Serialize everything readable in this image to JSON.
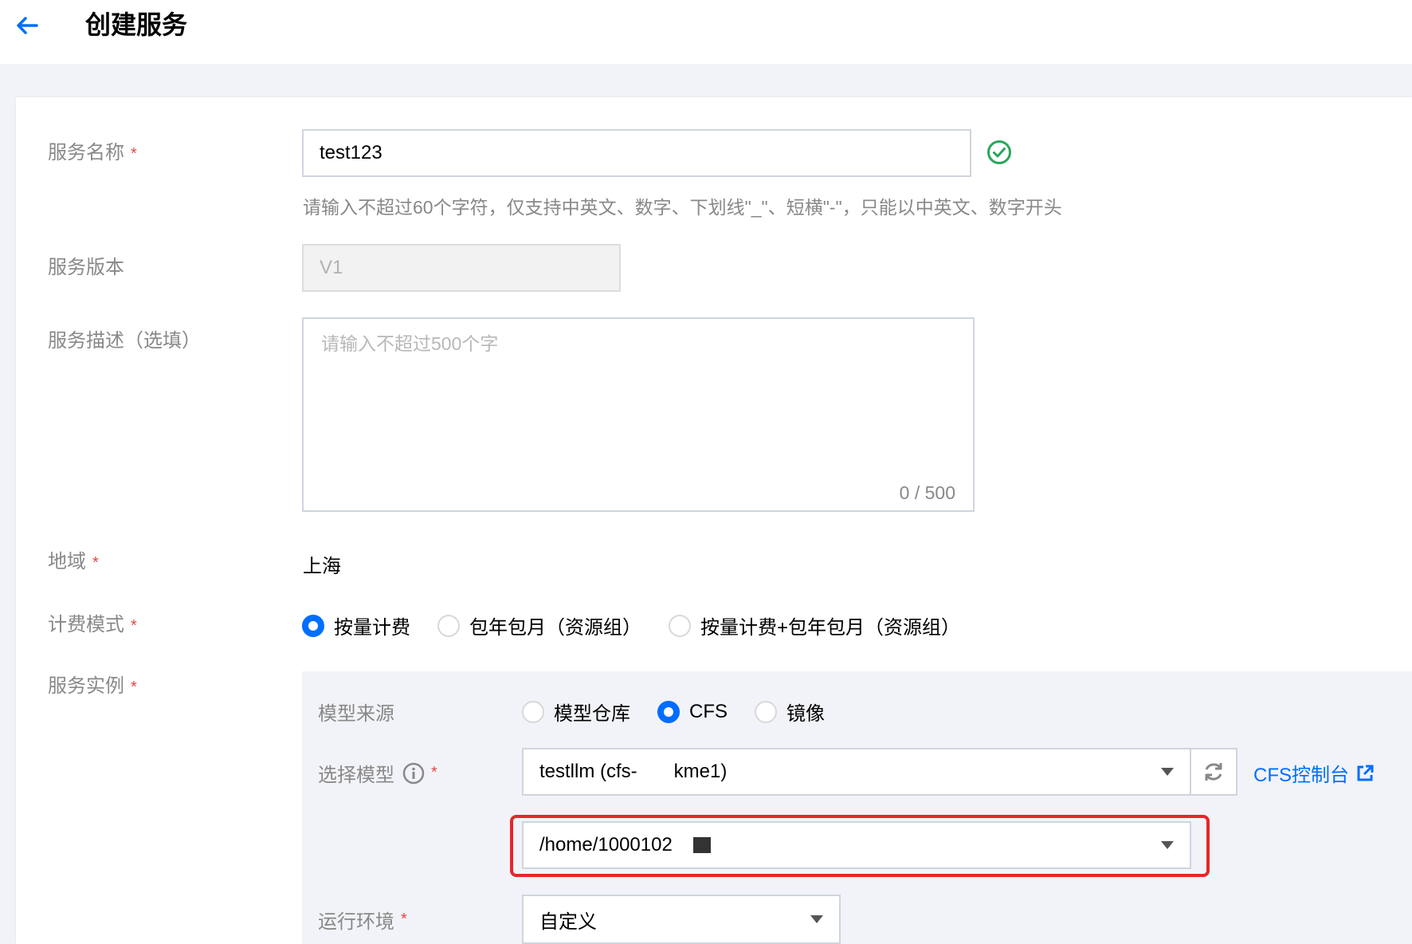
{
  "header": {
    "title": "创建服务"
  },
  "form": {
    "service_name": {
      "label": "服务名称",
      "required_mark": "*",
      "value": "test123",
      "hint": "请输入不超过60个字符，仅支持中英文、数字、下划线\"_\"、短横\"-\"，只能以中英文、数字开头"
    },
    "service_version": {
      "label": "服务版本",
      "value": "V1"
    },
    "service_desc": {
      "label": "服务描述（选填）",
      "placeholder": "请输入不超过500个字",
      "counter": "0 / 500"
    },
    "region": {
      "label": "地域",
      "required_mark": "*",
      "value": "上海"
    },
    "billing": {
      "label": "计费模式",
      "required_mark": "*",
      "options": [
        "按量计费",
        "包年包月（资源组）",
        "按量计费+包年包月（资源组）"
      ],
      "selected": "按量计费"
    },
    "instance": {
      "label": "服务实例",
      "required_mark": "*",
      "model_source": {
        "label": "模型来源",
        "options": [
          "模型仓库",
          "CFS",
          "镜像"
        ],
        "selected": "CFS"
      },
      "select_model": {
        "label": "选择模型",
        "required_mark": "*",
        "value": "testllm (cfs-",
        "value_suffix": "kme1)",
        "path_value": "/home/1000102",
        "cfs_console_link": "CFS控制台"
      },
      "runtime": {
        "label": "运行环境",
        "required_mark": "*",
        "value": "自定义"
      }
    }
  },
  "colors": {
    "accent": "#006eff",
    "success": "#29a65b",
    "required": "#e54545",
    "highlight": "#e8262a",
    "label": "#888888"
  },
  "icons": [
    "arrow-left-icon",
    "check-circle-icon",
    "info-icon",
    "refresh-icon",
    "external-link-icon",
    "chevron-down-icon"
  ]
}
